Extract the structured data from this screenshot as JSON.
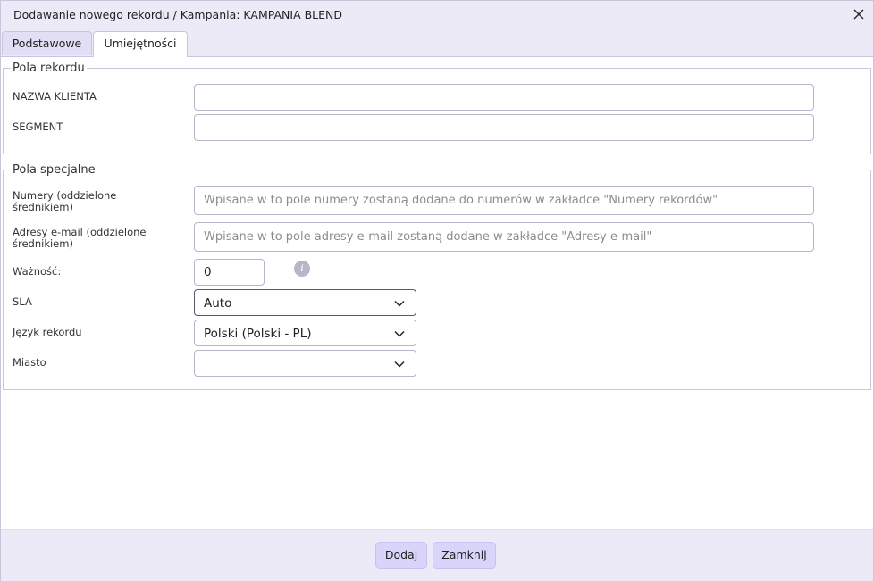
{
  "dialog": {
    "title": "Dodawanie nowego rekordu / Kampania: KAMPANIA BLEND"
  },
  "tabs": [
    {
      "label": "Podstawowe"
    },
    {
      "label": "Umiejętności"
    }
  ],
  "record_fields": {
    "legend": "Pola rekordu",
    "client_name": {
      "label": "NAZWA KLIENTA",
      "value": ""
    },
    "segment": {
      "label": "SEGMENT",
      "value": ""
    }
  },
  "special_fields": {
    "legend": "Pola specjalne",
    "numbers": {
      "label_line1": "Numery (oddzielone",
      "label_line2": "średnikiem)",
      "placeholder": "Wpisane w to pole numery zostaną dodane do numerów w zakładce \"Numery rekordów\""
    },
    "emails": {
      "label_line1": "Adresy e-mail (oddzielone",
      "label_line2": "średnikiem)",
      "placeholder": "Wpisane w to pole adresy e-mail zostaną dodane w zakładce \"Adresy e-mail\""
    },
    "validity": {
      "label": "Ważność:",
      "value": "0"
    },
    "sla": {
      "label": "SLA",
      "selected": "Auto"
    },
    "language": {
      "label": "Język rekordu",
      "selected": "Polski (Polski - PL)"
    },
    "city": {
      "label": "Miasto",
      "selected": ""
    }
  },
  "footer": {
    "add_label": "Dodaj",
    "close_label": "Zamknij"
  },
  "icons": {
    "close": "close-icon",
    "info": "info-icon",
    "chevron": "chevron-down-icon"
  },
  "colors": {
    "accent_button": "#d8d4fa",
    "header_bg": "#edeaf8"
  }
}
